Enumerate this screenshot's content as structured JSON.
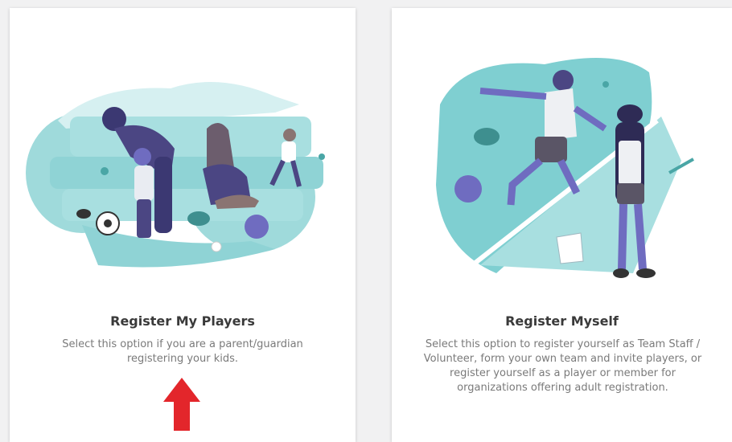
{
  "cards": [
    {
      "title": "Register My Players",
      "description": "Select this option if you are a parent/guardian registering your kids."
    },
    {
      "title": "Register Myself",
      "description": "Select this option to register yourself as Team Staff / Volunteer, form your own team and invite players, or register yourself as a player or member for organizations offering adult registration."
    }
  ],
  "colors": {
    "teal_light": "#a8dfe0",
    "teal": "#7fcfd1",
    "purple": "#6f6cc0",
    "purple_dark": "#4b4683",
    "arrow": "#e3262b"
  },
  "annotation": {
    "icon": "red-up-arrow"
  }
}
